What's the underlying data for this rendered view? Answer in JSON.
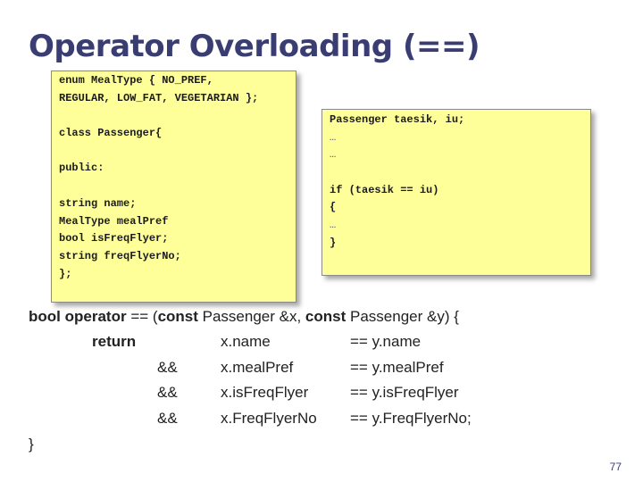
{
  "slide": {
    "title": "Operator Overloading (==)",
    "page_number": "77"
  },
  "left_code": [
    "enum MealType { NO_PREF,",
    "REGULAR, LOW_FAT, VEGETARIAN };",
    "",
    "class Passenger{",
    "",
    "public:",
    "",
    "string name;",
    "MealType mealPref",
    "bool isFreqFlyer;",
    "string freqFlyerNo;",
    "};"
  ],
  "right_code": [
    "Passenger taesik, iu;",
    "…",
    "…",
    "",
    "if (taesik == iu)",
    "{",
    "…",
    "}"
  ],
  "operator_code": {
    "signature": {
      "kw_bool": "bool",
      "kw_operator": "operator",
      "eq_open": " == (",
      "kw_const1": "const",
      "param1": " Passenger &x, ",
      "kw_const2": "const",
      "param2": " Passenger &y) {"
    },
    "return_keyword": "return",
    "rows": [
      {
        "op": "",
        "lhs": "x.name",
        "rhs": "== y.name"
      },
      {
        "op": "&&",
        "lhs": "x.mealPref",
        "rhs": "== y.mealPref"
      },
      {
        "op": "&&",
        "lhs": "x.isFreqFlyer",
        "rhs": "== y.isFreqFlyer"
      },
      {
        "op": "&&",
        "lhs": "x.FreqFlyerNo",
        "rhs": "== y.FreqFlyerNo;"
      }
    ],
    "closing_brace": "}"
  }
}
